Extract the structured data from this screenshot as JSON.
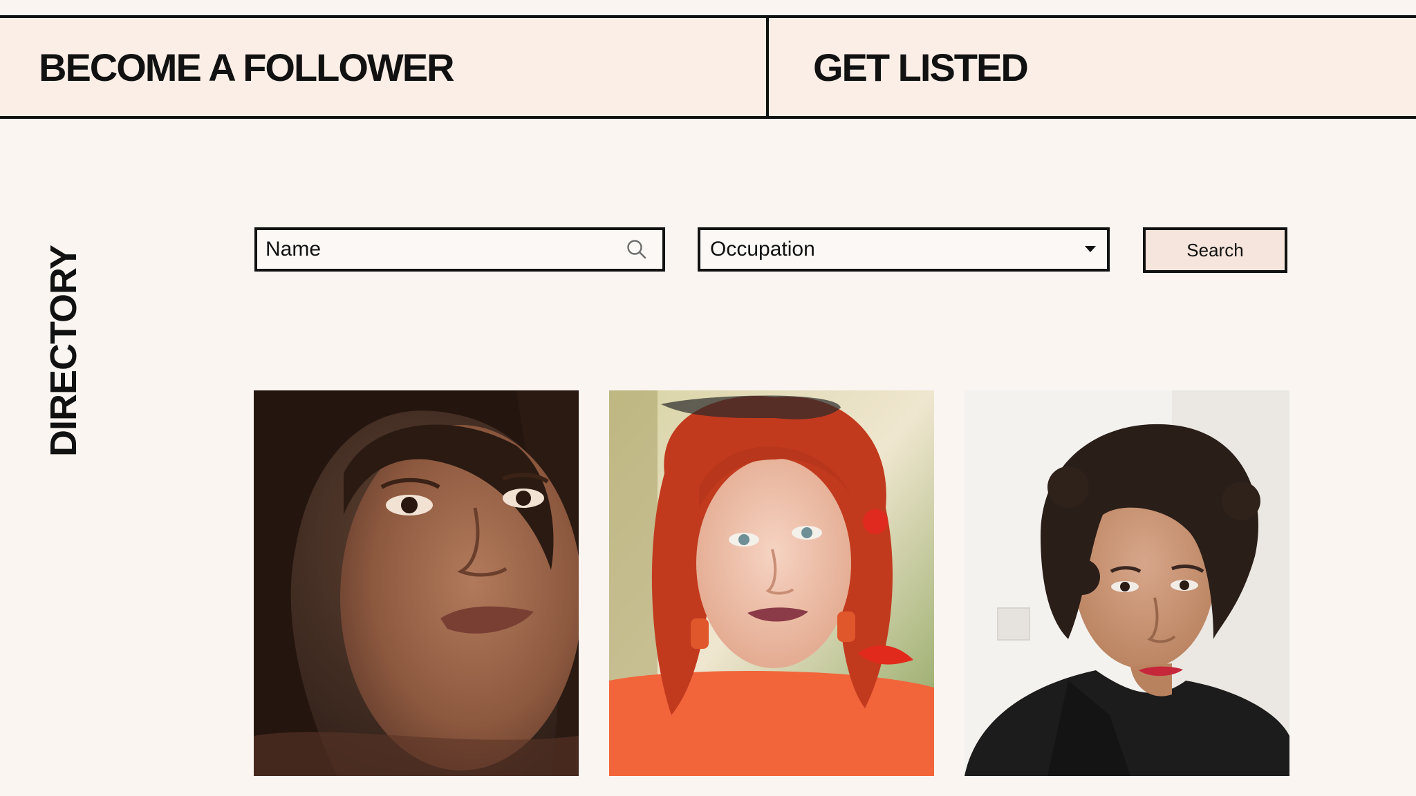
{
  "nav": {
    "follower_label": "BECOME A FOLLOWER",
    "listed_label": "GET LISTED"
  },
  "directory": {
    "heading": "DIRECTORY"
  },
  "filters": {
    "name_placeholder": "Name",
    "occupation_value": "Occupation",
    "search_label": "Search"
  },
  "icons": {
    "search": "search-icon",
    "caret": "chevron-down-icon"
  },
  "profiles": [
    {
      "photo": "portrait-photo-1",
      "background": "#3a2a20"
    },
    {
      "photo": "portrait-photo-2",
      "background": "#e7dcc3"
    },
    {
      "photo": "portrait-photo-3",
      "background": "#f3f1ee"
    }
  ]
}
